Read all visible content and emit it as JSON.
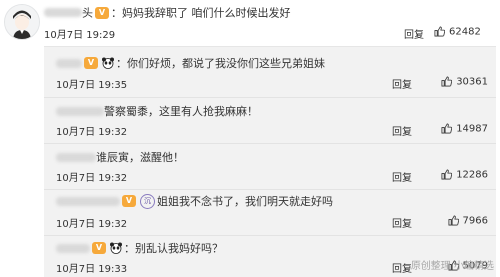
{
  "post": {
    "author_suffix": "头",
    "text": "：妈妈我辞职了 咱们什么时候出发好",
    "date": "10月7日",
    "time": "19:29",
    "reply_label": "回复",
    "likes": "62482"
  },
  "replies": [
    {
      "text": "：你们好烦，都说了我没你们这些兄弟姐妹",
      "date": "10月7日",
      "time": "19:35",
      "reply_label": "回复",
      "likes": "30361"
    },
    {
      "text": "警察蜀黍，这里有人抢我麻麻！",
      "date": "10月7日",
      "time": "19:32",
      "reply_label": "回复",
      "likes": "14987"
    },
    {
      "text": "谁辰寅，滋醒他！",
      "date": "10月7日",
      "time": "19:32",
      "reply_label": "回复",
      "likes": "12286"
    },
    {
      "text": "姐姐我不念书了，我们明天就走好吗",
      "date": "10月7日",
      "time": "19:32",
      "reply_label": "回复",
      "likes": "7966"
    },
    {
      "text": "：别乱认我妈好吗？",
      "date": "10月7日",
      "time": "19:33",
      "reply_label": "回复",
      "likes": "5079"
    }
  ],
  "badges": {
    "vip": "V",
    "vip_panda": "♥",
    "ring": "沉"
  },
  "icons": {
    "like": "thumb-up-icon",
    "vip": "vip-badge-icon",
    "panda": "panda-emoji-icon"
  },
  "watermark": "原创整理 小编精选"
}
